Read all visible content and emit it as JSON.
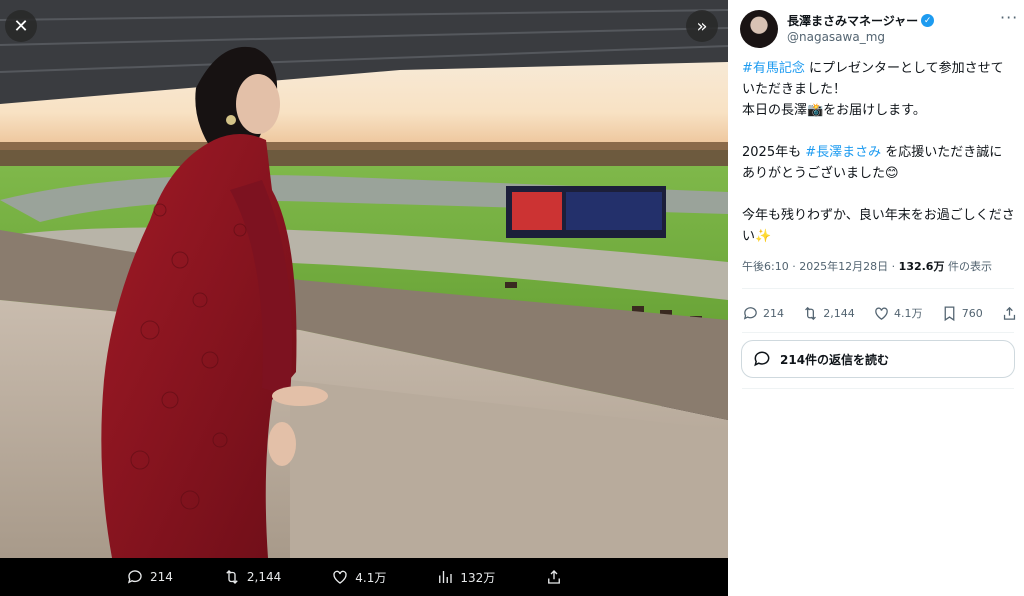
{
  "media_viewer": {
    "close_icon": "close-icon",
    "next_icon": "double-chevron-right-icon",
    "bar": {
      "reply_count": "214",
      "retweet_count": "2,144",
      "like_count": "4.1万",
      "view_count": "132万"
    }
  },
  "tweet": {
    "author": {
      "name": "長澤まさみマネージャー",
      "handle": "@nagasawa_mg",
      "verified": true
    },
    "text": {
      "hashtag1": "#有馬記念",
      "line1_rest": " にプレゼンターとして参加させて",
      "line2": "いただきました！",
      "line3": "本日の長澤📸をお届けします。",
      "line4_prefix": "2025年も ",
      "hashtag2": "#長澤まさみ",
      "line4_rest": " を応援いただき誠に",
      "line5": "ありがとうございました😊",
      "line6": "今年も残りわずか、良い年末をお過ごしくださ",
      "line7": "い✨"
    },
    "timestamp": "午後6:10 · 2025年12月28日 · ",
    "views_count": "132.6万",
    "views_label": " 件の表示",
    "actions": {
      "reply_count": "214",
      "retweet_count": "2,144",
      "like_count": "4.1万",
      "bookmark_count": "760"
    },
    "read_replies_label": "214件の返信を読む"
  },
  "colors": {
    "link": "#1d9bf0",
    "text": "#0f1419",
    "secondary": "#536471",
    "dress": "#8e1420"
  }
}
